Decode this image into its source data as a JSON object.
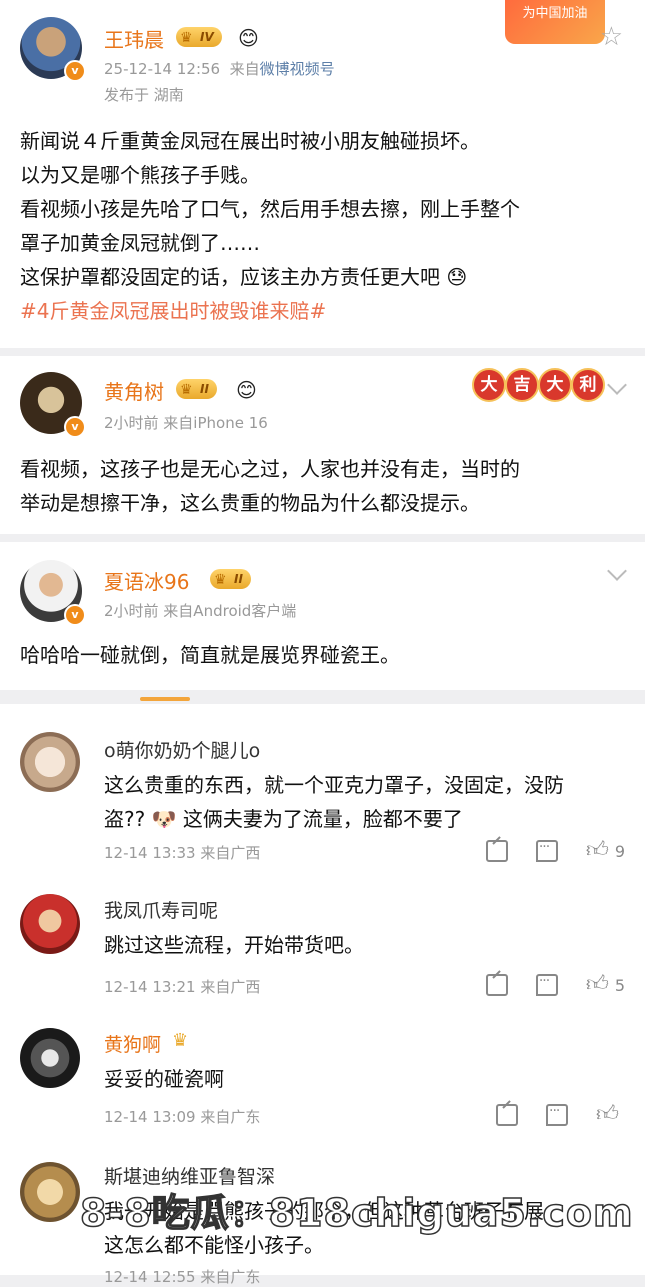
{
  "post": {
    "username": "王玮晨",
    "level": "IV",
    "timestamp": "25-12-14 12:56",
    "source_prefix": "来自",
    "source": "微博视频号",
    "location": "发布于 湖南",
    "lines": [
      "新闻说４斤重黄金凤冠在展出时被小朋友触碰损坏。",
      "以为又是哪个熊孩子手贱。",
      "看视频小孩是先哈了口气，然后用手想去擦，刚上手整个",
      "罩子加黄金凤冠就倒了……",
      "这保护罩都没固定的话，应该主办方责任更大吧"
    ],
    "hashtag": "#4斤黄金凤冠展出时被毁谁来赔#",
    "promo_label": "为中国加油"
  },
  "comments_top": [
    {
      "username": "黄角树",
      "level": "II",
      "meta": "2小时前  来自iPhone 16",
      "badges": [
        "大",
        "吉",
        "大",
        "利"
      ],
      "lines": [
        "看视频，这孩子也是无心之过，人家也并没有走，当时的",
        "举动是想擦干净，这么贵重的物品为什么都没提示。"
      ]
    },
    {
      "username": "夏语冰96",
      "level": "II",
      "meta": "2小时前  来自Android客户端",
      "lines": [
        "哈哈哈一碰就倒，简直就是展览界碰瓷王。"
      ]
    }
  ],
  "replies": [
    {
      "username": "o萌你奶奶个腿儿o",
      "lines": [
        "这么贵重的东西，就一个亚克力罩子，没固定，没防",
        "盗??  🐶  这俩夫妻为了流量，脸都不要了"
      ],
      "meta": "12-14 13:33  来自广西",
      "likes": "9"
    },
    {
      "username": "我凤爪寿司呢",
      "lines": [
        "跳过这些流程，开始带货吧。"
      ],
      "meta": "12-14 13:21  来自广西",
      "likes": "5"
    },
    {
      "username": "黄狗啊",
      "lines": [
        "妥妥的碰瓷啊"
      ],
      "meta": "12-14 13:09  来自广东",
      "likes": ""
    },
    {
      "username": "斯堪迪纳维亚鲁智深",
      "lines": [
        "我一开始是骂熊孩子的那个，但这种草台班子布展，",
        "这怎么都不能怪小孩子。"
      ],
      "meta": "12-14 12:55  来自广东",
      "likes": ""
    }
  ],
  "watermark": "8-8吃瓜：818chigua5.com"
}
